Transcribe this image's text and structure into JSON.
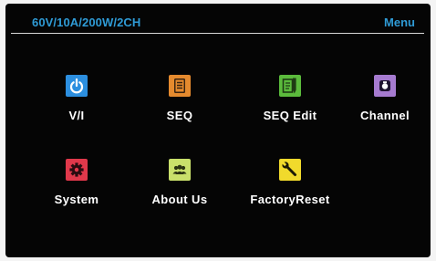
{
  "header": {
    "model": "60V/10A/200W/2CH",
    "title": "Menu"
  },
  "menu": {
    "items": [
      {
        "label": "V/I",
        "icon": "power-icon",
        "color": "#2c8fe0"
      },
      {
        "label": "SEQ",
        "icon": "document-icon",
        "color": "#e58a2e"
      },
      {
        "label": "SEQ Edit",
        "icon": "edit-document-icon",
        "color": "#5bbb3c"
      },
      {
        "label": "Channel",
        "icon": "channel-icon",
        "color": "#a67bd0"
      },
      {
        "label": "System",
        "icon": "gear-icon",
        "color": "#e0384b"
      },
      {
        "label": "About Us",
        "icon": "people-icon",
        "color": "#c9e06b"
      },
      {
        "label": "FactoryReset",
        "icon": "wrench-icon",
        "color": "#f1da2c"
      }
    ]
  }
}
